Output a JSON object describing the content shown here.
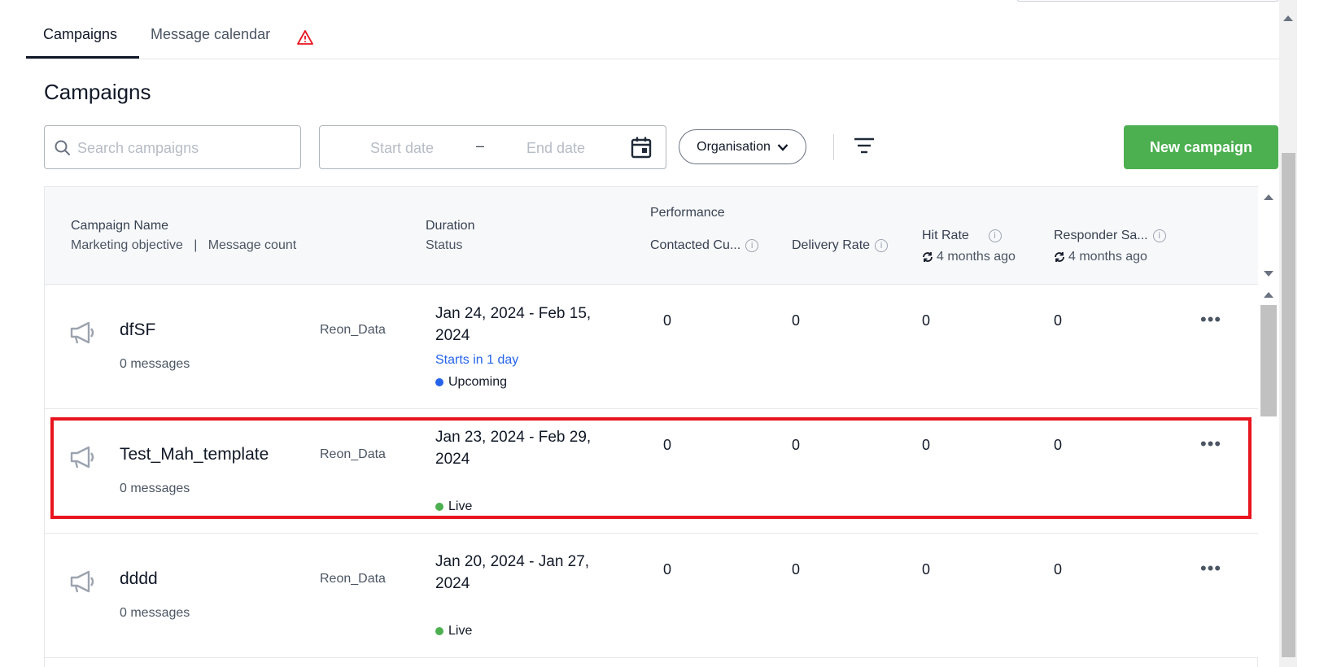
{
  "tabs": [
    {
      "label": "Campaigns",
      "active": true
    },
    {
      "label": "Message calendar",
      "warning_icon": "warning-triangle-icon"
    }
  ],
  "page_title": "Campaigns",
  "toolbar": {
    "search_placeholder": "Search campaigns",
    "start_date_placeholder": "Start date",
    "date_separator": "–",
    "end_date_placeholder": "End date",
    "organisation_label": "Organisation",
    "new_campaign_label": "New campaign"
  },
  "table": {
    "headers": {
      "campaign_name": "Campaign Name",
      "marketing_objective": "Marketing objective",
      "separator": "|",
      "message_count": "Message count",
      "duration": "Duration",
      "status": "Status",
      "performance": "Performance",
      "contacted": "Contacted Cu...",
      "delivery_rate": "Delivery Rate",
      "hit_rate": "Hit Rate",
      "hit_rate_updated": "4 months ago",
      "responder": "Responder Sa...",
      "responder_updated": "4 months ago"
    },
    "rows": [
      {
        "name": "dfSF",
        "messages": "0 messages",
        "objective": "Reon_Data",
        "duration": "Jan 24, 2024 - Feb 15, 2024",
        "starts": "Starts in 1 day",
        "status": "Upcoming",
        "status_color": "#2563eb",
        "contacted": "0",
        "delivery": "0",
        "hit": "0",
        "responder": "0"
      },
      {
        "name": "Test_Mah_template",
        "messages": "0 messages",
        "objective": "Reon_Data",
        "duration": "Jan 23, 2024 - Feb 29, 2024",
        "starts": "",
        "status": "Live",
        "status_color": "#4caf50",
        "contacted": "0",
        "delivery": "0",
        "hit": "0",
        "responder": "0"
      },
      {
        "name": "dddd",
        "messages": "0 messages",
        "objective": "Reon_Data",
        "duration": "Jan 20, 2024 - Jan 27, 2024",
        "starts": "",
        "status": "Live",
        "status_color": "#4caf50",
        "contacted": "0",
        "delivery": "0",
        "hit": "0",
        "responder": "0"
      }
    ],
    "more_label": "•••"
  },
  "colors": {
    "primary_button": "#4caf50",
    "highlight": "#e8141e",
    "upcoming": "#2563eb",
    "live": "#4caf50"
  }
}
